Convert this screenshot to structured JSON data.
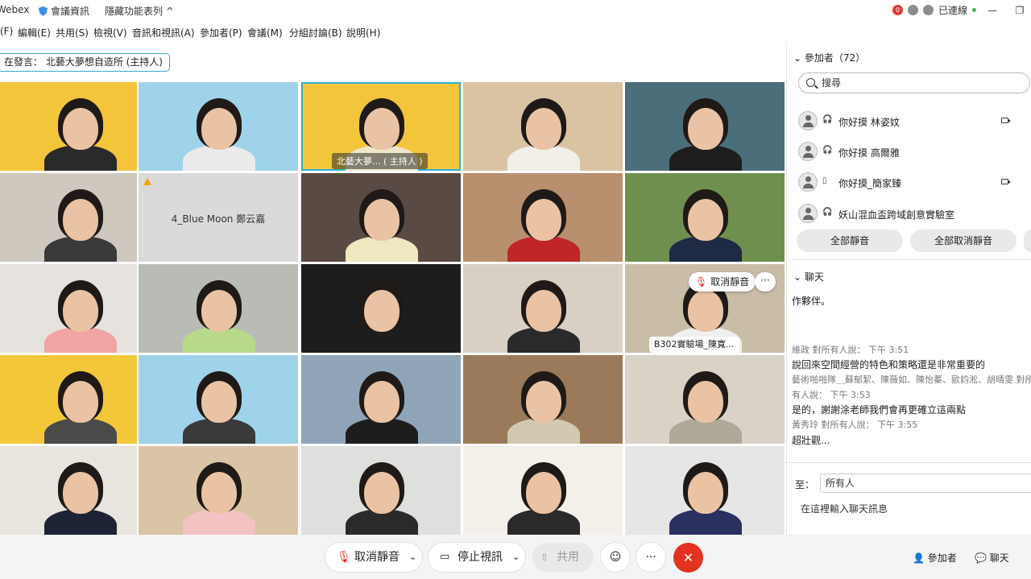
{
  "titlebar": {
    "app_name": "Webex",
    "meeting_info": "會議資訊",
    "hidden_list": "隱藏功能表列 ^",
    "status": "已連線",
    "notification_count": "0",
    "restore_icon": "restore-icon",
    "minimize_icon": "minimize-icon"
  },
  "menu": {
    "items": [
      "(F)",
      "編輯(E)",
      "共用(S)",
      "檢視(V)",
      "音訊和視訊(A)",
      "參加者(P)",
      "會議(M)",
      "分組討論(B)",
      "說明(H)"
    ]
  },
  "speaking": "在發言： 北藝大夢想自造所 (主持人)",
  "grid": {
    "host_label": "北藝大夢... ( 主持人 )",
    "no_video_name": "4_Blue Moon 鄭云嘉",
    "unmute_popup": "取消靜音",
    "more": "···",
    "b302_label": "B302實驗場_陳寬..."
  },
  "participants": {
    "title": "參加者（72）",
    "search_placeholder": "搜尋",
    "list": [
      {
        "name": "你好摸 林姿妏",
        "video": true
      },
      {
        "name": "你好摸 高爾雅",
        "video": false
      },
      {
        "name": "你好摸_簡家臻",
        "video": true
      },
      {
        "name": "妖山混血盃跨域創意實驗室",
        "video": false
      }
    ],
    "mute_all": "全部靜音",
    "unmute_all": "全部取消靜音"
  },
  "chat": {
    "title": "聊天",
    "messages": [
      {
        "text": "作夥伴。"
      },
      {
        "meta": "維政 對所有人說：   下午 3:51"
      },
      {
        "text": "說回來空間經營的特色和策略還是非常重要的"
      },
      {
        "meta": "藝術啪啪隊＿蘇郁絜、陳薇如、陳怡蓁、歐鈞淞、胡晴雯 對所"
      },
      {
        "meta": "有人說：   下午 3:53"
      },
      {
        "text": "是的，謝謝涂老師我們會再更確立這兩點"
      },
      {
        "meta": "黃秀玲 對所有人說：   下午 3:55"
      },
      {
        "text": "超壯觀..."
      }
    ],
    "to_label": "至：",
    "to_value": "所有人",
    "input_placeholder": "在這裡輸入聊天訊息"
  },
  "controls": {
    "unmute": "取消靜音",
    "stop_video": "停止視訊",
    "share": "共用",
    "more": "···",
    "end": "✕",
    "participants_tab": "參加者",
    "chat_tab": "聊天"
  },
  "colors": {
    "accent": "#2bb0d6",
    "end_red": "#e2331f",
    "status_green": "#3fb950"
  }
}
